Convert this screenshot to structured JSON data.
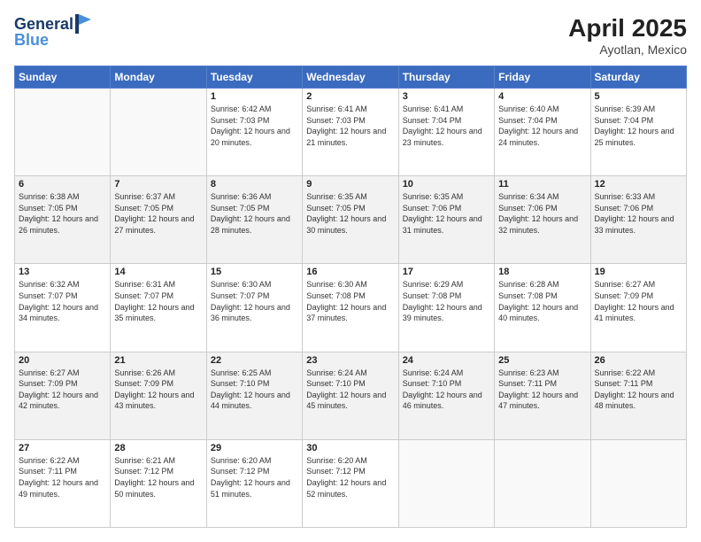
{
  "header": {
    "logo_line1": "General",
    "logo_line2": "Blue",
    "title": "April 2025",
    "subtitle": "Ayotlan, Mexico"
  },
  "days_of_week": [
    "Sunday",
    "Monday",
    "Tuesday",
    "Wednesday",
    "Thursday",
    "Friday",
    "Saturday"
  ],
  "weeks": [
    [
      {
        "day": "",
        "info": ""
      },
      {
        "day": "",
        "info": ""
      },
      {
        "day": "1",
        "info": "Sunrise: 6:42 AM\nSunset: 7:03 PM\nDaylight: 12 hours and 20 minutes."
      },
      {
        "day": "2",
        "info": "Sunrise: 6:41 AM\nSunset: 7:03 PM\nDaylight: 12 hours and 21 minutes."
      },
      {
        "day": "3",
        "info": "Sunrise: 6:41 AM\nSunset: 7:04 PM\nDaylight: 12 hours and 23 minutes."
      },
      {
        "day": "4",
        "info": "Sunrise: 6:40 AM\nSunset: 7:04 PM\nDaylight: 12 hours and 24 minutes."
      },
      {
        "day": "5",
        "info": "Sunrise: 6:39 AM\nSunset: 7:04 PM\nDaylight: 12 hours and 25 minutes."
      }
    ],
    [
      {
        "day": "6",
        "info": "Sunrise: 6:38 AM\nSunset: 7:05 PM\nDaylight: 12 hours and 26 minutes."
      },
      {
        "day": "7",
        "info": "Sunrise: 6:37 AM\nSunset: 7:05 PM\nDaylight: 12 hours and 27 minutes."
      },
      {
        "day": "8",
        "info": "Sunrise: 6:36 AM\nSunset: 7:05 PM\nDaylight: 12 hours and 28 minutes."
      },
      {
        "day": "9",
        "info": "Sunrise: 6:35 AM\nSunset: 7:05 PM\nDaylight: 12 hours and 30 minutes."
      },
      {
        "day": "10",
        "info": "Sunrise: 6:35 AM\nSunset: 7:06 PM\nDaylight: 12 hours and 31 minutes."
      },
      {
        "day": "11",
        "info": "Sunrise: 6:34 AM\nSunset: 7:06 PM\nDaylight: 12 hours and 32 minutes."
      },
      {
        "day": "12",
        "info": "Sunrise: 6:33 AM\nSunset: 7:06 PM\nDaylight: 12 hours and 33 minutes."
      }
    ],
    [
      {
        "day": "13",
        "info": "Sunrise: 6:32 AM\nSunset: 7:07 PM\nDaylight: 12 hours and 34 minutes."
      },
      {
        "day": "14",
        "info": "Sunrise: 6:31 AM\nSunset: 7:07 PM\nDaylight: 12 hours and 35 minutes."
      },
      {
        "day": "15",
        "info": "Sunrise: 6:30 AM\nSunset: 7:07 PM\nDaylight: 12 hours and 36 minutes."
      },
      {
        "day": "16",
        "info": "Sunrise: 6:30 AM\nSunset: 7:08 PM\nDaylight: 12 hours and 37 minutes."
      },
      {
        "day": "17",
        "info": "Sunrise: 6:29 AM\nSunset: 7:08 PM\nDaylight: 12 hours and 39 minutes."
      },
      {
        "day": "18",
        "info": "Sunrise: 6:28 AM\nSunset: 7:08 PM\nDaylight: 12 hours and 40 minutes."
      },
      {
        "day": "19",
        "info": "Sunrise: 6:27 AM\nSunset: 7:09 PM\nDaylight: 12 hours and 41 minutes."
      }
    ],
    [
      {
        "day": "20",
        "info": "Sunrise: 6:27 AM\nSunset: 7:09 PM\nDaylight: 12 hours and 42 minutes."
      },
      {
        "day": "21",
        "info": "Sunrise: 6:26 AM\nSunset: 7:09 PM\nDaylight: 12 hours and 43 minutes."
      },
      {
        "day": "22",
        "info": "Sunrise: 6:25 AM\nSunset: 7:10 PM\nDaylight: 12 hours and 44 minutes."
      },
      {
        "day": "23",
        "info": "Sunrise: 6:24 AM\nSunset: 7:10 PM\nDaylight: 12 hours and 45 minutes."
      },
      {
        "day": "24",
        "info": "Sunrise: 6:24 AM\nSunset: 7:10 PM\nDaylight: 12 hours and 46 minutes."
      },
      {
        "day": "25",
        "info": "Sunrise: 6:23 AM\nSunset: 7:11 PM\nDaylight: 12 hours and 47 minutes."
      },
      {
        "day": "26",
        "info": "Sunrise: 6:22 AM\nSunset: 7:11 PM\nDaylight: 12 hours and 48 minutes."
      }
    ],
    [
      {
        "day": "27",
        "info": "Sunrise: 6:22 AM\nSunset: 7:11 PM\nDaylight: 12 hours and 49 minutes."
      },
      {
        "day": "28",
        "info": "Sunrise: 6:21 AM\nSunset: 7:12 PM\nDaylight: 12 hours and 50 minutes."
      },
      {
        "day": "29",
        "info": "Sunrise: 6:20 AM\nSunset: 7:12 PM\nDaylight: 12 hours and 51 minutes."
      },
      {
        "day": "30",
        "info": "Sunrise: 6:20 AM\nSunset: 7:12 PM\nDaylight: 12 hours and 52 minutes."
      },
      {
        "day": "",
        "info": ""
      },
      {
        "day": "",
        "info": ""
      },
      {
        "day": "",
        "info": ""
      }
    ]
  ]
}
